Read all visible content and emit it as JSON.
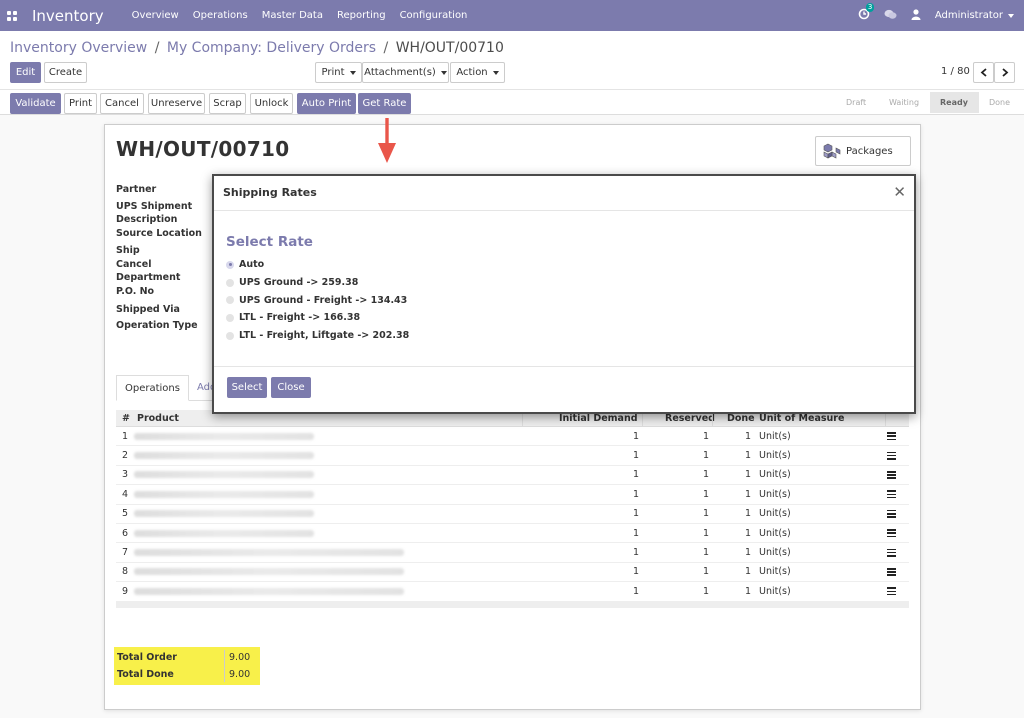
{
  "navbar": {
    "app_name": "Inventory",
    "menu": [
      "Overview",
      "Operations",
      "Master Data",
      "Reporting",
      "Configuration"
    ],
    "activity_count": "3",
    "user": "Administrator"
  },
  "breadcrumb": {
    "items": [
      "Inventory Overview",
      "My Company: Delivery Orders",
      "WH/OUT/00710"
    ],
    "separator": "/"
  },
  "toolbar": {
    "edit": "Edit",
    "create": "Create",
    "print": "Print",
    "attachments": "Attachment(s)",
    "action": "Action",
    "pager": "1 / 80"
  },
  "actions": {
    "validate": "Validate",
    "print": "Print",
    "cancel": "Cancel",
    "unreserve": "Unreserve",
    "scrap": "Scrap",
    "unlock": "Unlock",
    "auto_print": "Auto Print",
    "get_rate": "Get Rate"
  },
  "status": {
    "stages": [
      "Draft",
      "Waiting",
      "Ready",
      "Done"
    ],
    "active": "Ready"
  },
  "record": {
    "title": "WH/OUT/00710",
    "packages": "Packages",
    "field_labels": [
      "Partner",
      "UPS Shipment Description",
      "Source Location",
      "Ship Cancel",
      "Department",
      "P.O. No",
      "Shipped Via",
      "Operation Type"
    ],
    "tabs": [
      "Operations",
      "Addi"
    ]
  },
  "grid": {
    "headers": {
      "num": "#",
      "product": "Product",
      "initial_demand": "Initial Demand",
      "reserved": "Reserved",
      "done": "Done",
      "uom": "Unit of Measure"
    },
    "rows": [
      {
        "n": "1",
        "demand": "1",
        "reserved": "1",
        "done": "1",
        "uom": "Unit(s)"
      },
      {
        "n": "2",
        "demand": "1",
        "reserved": "1",
        "done": "1",
        "uom": "Unit(s)"
      },
      {
        "n": "3",
        "demand": "1",
        "reserved": "1",
        "done": "1",
        "uom": "Unit(s)"
      },
      {
        "n": "4",
        "demand": "1",
        "reserved": "1",
        "done": "1",
        "uom": "Unit(s)"
      },
      {
        "n": "5",
        "demand": "1",
        "reserved": "1",
        "done": "1",
        "uom": "Unit(s)"
      },
      {
        "n": "6",
        "demand": "1",
        "reserved": "1",
        "done": "1",
        "uom": "Unit(s)"
      },
      {
        "n": "7",
        "demand": "1",
        "reserved": "1",
        "done": "1",
        "uom": "Unit(s)"
      },
      {
        "n": "8",
        "demand": "1",
        "reserved": "1",
        "done": "1",
        "uom": "Unit(s)"
      },
      {
        "n": "9",
        "demand": "1",
        "reserved": "1",
        "done": "1",
        "uom": "Unit(s)"
      }
    ]
  },
  "totals": {
    "order_label": "Total Order",
    "order_value": "9.00",
    "done_label": "Total Done",
    "done_value": "9.00"
  },
  "modal": {
    "title": "Shipping Rates",
    "heading": "Select Rate",
    "options": [
      {
        "label": "Auto",
        "selected": true
      },
      {
        "label": "UPS Ground -> 259.38",
        "selected": false
      },
      {
        "label": "UPS Ground - Freight -> 134.43",
        "selected": false
      },
      {
        "label": "LTL - Freight -> 166.38",
        "selected": false
      },
      {
        "label": "LTL - Freight, Liftgate -> 202.38",
        "selected": false
      }
    ],
    "select_button": "Select",
    "close_button": "Close"
  },
  "colors": {
    "brand": "#7c7bad",
    "highlight": "#f8f04a",
    "arrow": "#e9564a"
  }
}
